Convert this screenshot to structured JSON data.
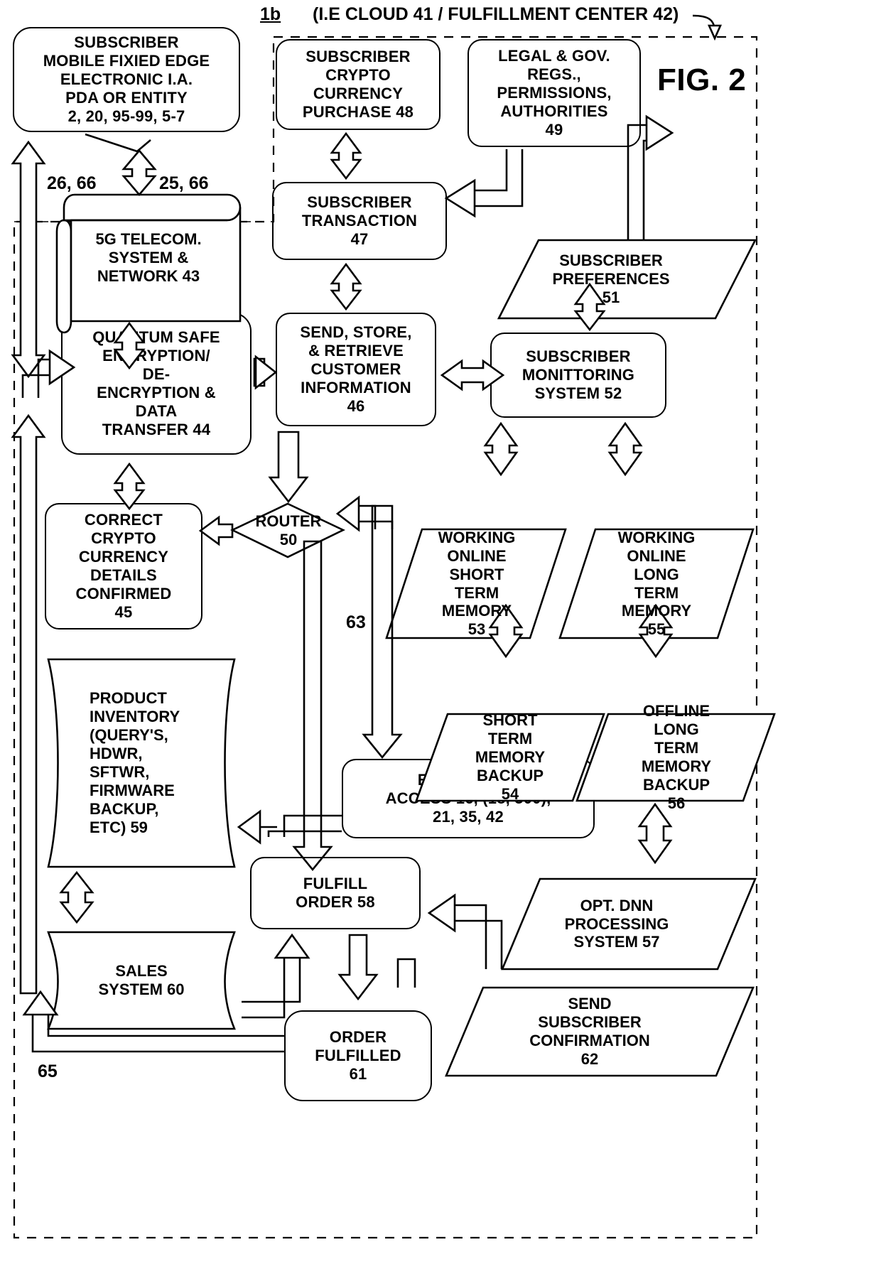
{
  "figure": {
    "fig_label": "FIG. 2",
    "sheet_ref": "1b",
    "header_note": "(I.E CLOUD 41 / FULFILLMENT CENTER 42)"
  },
  "nodes": {
    "subscriber_device": "SUBSCRIBER\nMOBILE FIXIED EDGE\nELECTRONIC I.A.\nPDA OR ENTITY\n2, 20, 95-99, 5-7",
    "telecom": "5G TELECOM.\nSYSTEM &\nNETWORK  43",
    "crypto_purchase": "SUBSCRIBER\nCRYPTO\nCURRENCY\nPURCHASE  48",
    "legal_gov": "LEGAL & GOV.\nREGS.,\nPERMISSIONS,\nAUTHORITIES\n49",
    "transaction": "SUBSCRIBER\nTRANSACTION\n47",
    "preferences": "SUBSCRIBER\nPREFERENCES\n51",
    "quantum": "QUANTUM SAFE\nENCRYPTION/\nDE-\nENCRYPTION &\nDATA\nTRANSFER  44",
    "send_store": "SEND, STORE,\n& RETRIEVE\nCUSTOMER\nINFORMATION\n46",
    "monitoring": "SUBSCRIBER\nMONITTORING\nSYSTEM  52",
    "router": "ROUTER\n50",
    "correct_crypto": "CORRECT\nCRYPTO\nCURRENCY\nDETAILS\nCONFIRMED\n45",
    "working_short": "WORKING\nONLINE\nSHORT\nTERM\nMEMORY\n53",
    "working_long": "WORKING\nONLINE\nLONG\nTERM\nMEMORY\n55",
    "short_backup": "SHORT\nTERM\nMEMORY\nBACKUP\n54",
    "offline_long_backup": "OFFLINE\nLONG\nTERM\nMEMORY\nBACKUP\n56",
    "product_inventory": "PRODUCT\nINVENTORY\n(QUERY'S,\nHDWR,\nSFTWR,\nFIRMWARE\nBACKUP,\nETC) 59",
    "enterprise_access": "ENTERPRISE\nACCESS 16, (18, 300),\n21, 35, 42",
    "fulfill_order": "FULFILL\nORDER 58",
    "opt_dnn": "OPT. DNN\nPROCESSING\nSYSTEM 57",
    "sales_system": "SALES\nSYSTEM 60",
    "order_fulfilled": "ORDER\nFULFILLED\n61",
    "send_confirmation": "SEND\nSUBSCRIBER\nCONFIRMATION\n62"
  },
  "edge_labels": {
    "l26_66": "26, 66",
    "l25_66": "25, 66",
    "l63": "63",
    "l65": "65"
  },
  "colors": {
    "stroke": "#000000",
    "background": "#ffffff"
  }
}
